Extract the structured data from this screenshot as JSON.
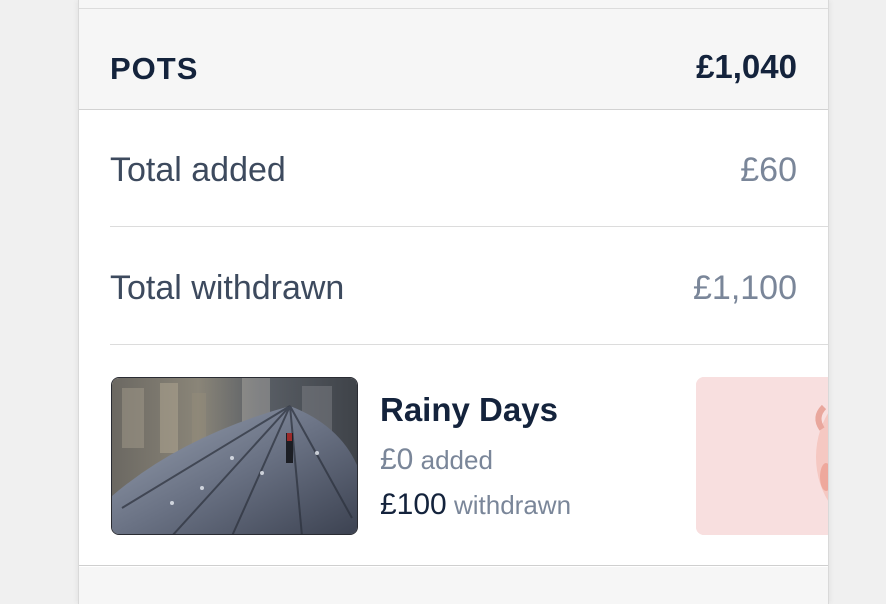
{
  "pots": {
    "header": {
      "title": "POTS",
      "total": "£1,040"
    },
    "summary": {
      "added_label": "Total added",
      "added_value": "£60",
      "withdrawn_label": "Total withdrawn",
      "withdrawn_value": "£1,100"
    },
    "items": [
      {
        "name": "Rainy Days",
        "added_amount": "£0",
        "added_suffix": "added",
        "withdrawn_amount": "£100",
        "withdrawn_suffix": "withdrawn",
        "image_icon": "umbrella-photo"
      },
      {
        "image_icon": "piggy-bank-photo"
      }
    ]
  },
  "colors": {
    "navy_text": "#14233c",
    "muted_text": "#7a8699",
    "header_bg": "#f6f6f6"
  }
}
